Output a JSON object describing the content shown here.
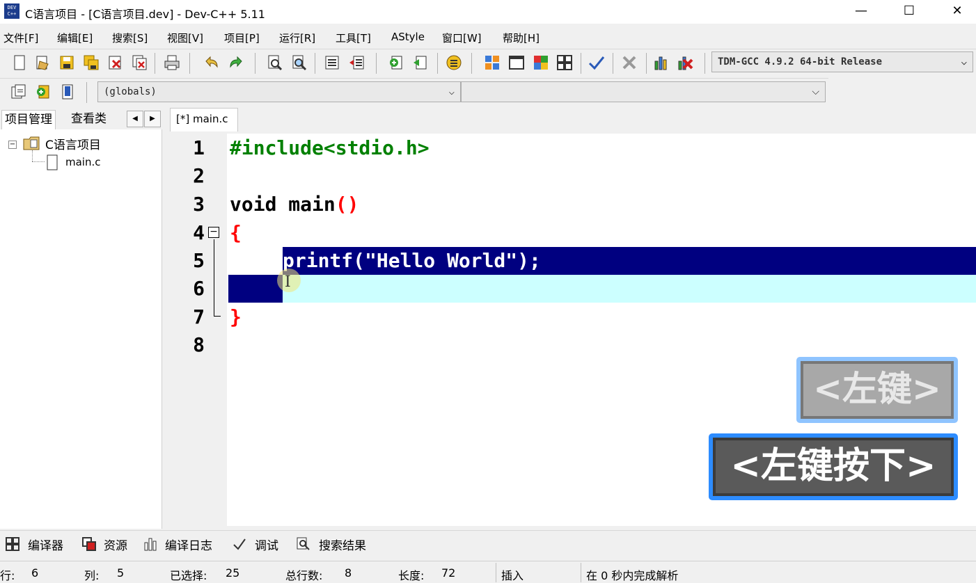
{
  "window": {
    "title": "C语言项目 - [C语言项目.dev] - Dev-C++ 5.11",
    "app_icon_text": "DEV C++",
    "minimize": "—",
    "maximize": "☐",
    "close": "✕"
  },
  "menu": [
    "文件[F]",
    "编辑[E]",
    "搜索[S]",
    "视图[V]",
    "项目[P]",
    "运行[R]",
    "工具[T]",
    "AStyle",
    "窗口[W]",
    "帮助[H]"
  ],
  "toolbar": {
    "compiler": "TDM-GCC 4.9.2 64-bit Release",
    "globals": "(globals)",
    "second_select": ""
  },
  "left_panel": {
    "tabs": [
      "项目管理",
      "查看类"
    ],
    "tree_root": "C语言项目",
    "tree_file": "main.c"
  },
  "editor": {
    "tab_label": "[*] main.c",
    "line_numbers": [
      "1",
      "2",
      "3",
      "4",
      "5",
      "6",
      "7",
      "8"
    ],
    "code": {
      "l1": "#include<stdio.h>",
      "l3_a": "void main",
      "l3_b": "()",
      "l4": "{",
      "l5": "printf(\"Hello World\");",
      "l7": "}"
    },
    "colors": {
      "preprocessor": "#008000",
      "keyword": "#000000",
      "symbol": "#ff0000",
      "selection": "#000080",
      "current_line": "#ccffff"
    }
  },
  "key_overlay": {
    "previous": "<左键>",
    "current": "<左键按下>"
  },
  "bottom_tabs": [
    "编译器",
    "资源",
    "编译日志",
    "调试",
    "搜索结果"
  ],
  "status": {
    "row_label": "行:",
    "row_value": "6",
    "col_label": "列:",
    "col_value": "5",
    "sel_label": "已选择:",
    "sel_value": "25",
    "lines_label": "总行数:",
    "lines_value": "8",
    "len_label": "长度:",
    "len_value": "72",
    "mode": "插入",
    "parse": "在 0 秒内完成解析"
  }
}
